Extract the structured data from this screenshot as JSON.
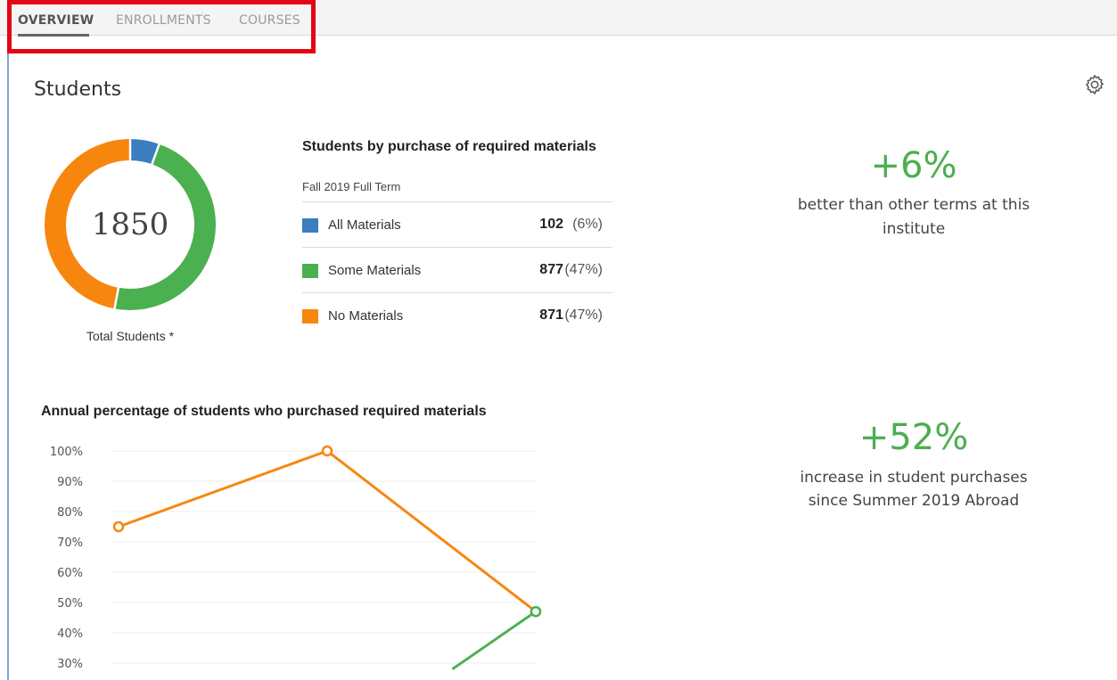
{
  "tabs": [
    {
      "label": "OVERVIEW",
      "active": true
    },
    {
      "label": "ENROLLMENTS",
      "active": false
    },
    {
      "label": "COURSES",
      "active": false
    }
  ],
  "panel": {
    "title": "Students",
    "settings_icon": "gear-icon"
  },
  "donut": {
    "total": "1850",
    "caption": "Total Students *"
  },
  "purchase_table": {
    "title": "Students by purchase of required materials",
    "term": "Fall 2019 Full Term",
    "rows": [
      {
        "label": "All Materials",
        "count": "102",
        "pct": "(6%)",
        "color": "#3a7ebf"
      },
      {
        "label": "Some Materials",
        "count": "877",
        "pct": "(47%)",
        "color": "#4bb04f"
      },
      {
        "label": "No Materials",
        "count": "871",
        "pct": "(47%)",
        "color": "#f7860f"
      }
    ]
  },
  "stats": [
    {
      "value": "+6%",
      "desc_line1": "better than other terms at this",
      "desc_line2": "institute"
    },
    {
      "value": "+52%",
      "desc_line1": "increase in student purchases",
      "desc_line2": "since Summer 2019 Abroad"
    }
  ],
  "colors": {
    "accent_green": "#4caf50",
    "orange": "#f7860f",
    "blue": "#3a7ebf",
    "green": "#4bb04f",
    "highlight_red": "#e30613"
  },
  "chart_data": {
    "type": "line",
    "title": "Annual percentage of students who purchased required materials",
    "y_ticks": [
      "100%",
      "90%",
      "80%",
      "70%",
      "60%",
      "50%",
      "40%",
      "30%"
    ],
    "ylim": [
      0,
      100
    ],
    "grid": true,
    "series": [
      {
        "color": "#f7860f",
        "points": [
          {
            "x": 0,
            "y": 75
          },
          {
            "x": 1,
            "y": 100
          },
          {
            "x": 2,
            "y": 47
          }
        ]
      },
      {
        "color": "#4bb04f",
        "points": [
          {
            "x": 1.6,
            "y": 28
          },
          {
            "x": 2,
            "y": 47
          }
        ]
      }
    ],
    "x_count": 3
  }
}
